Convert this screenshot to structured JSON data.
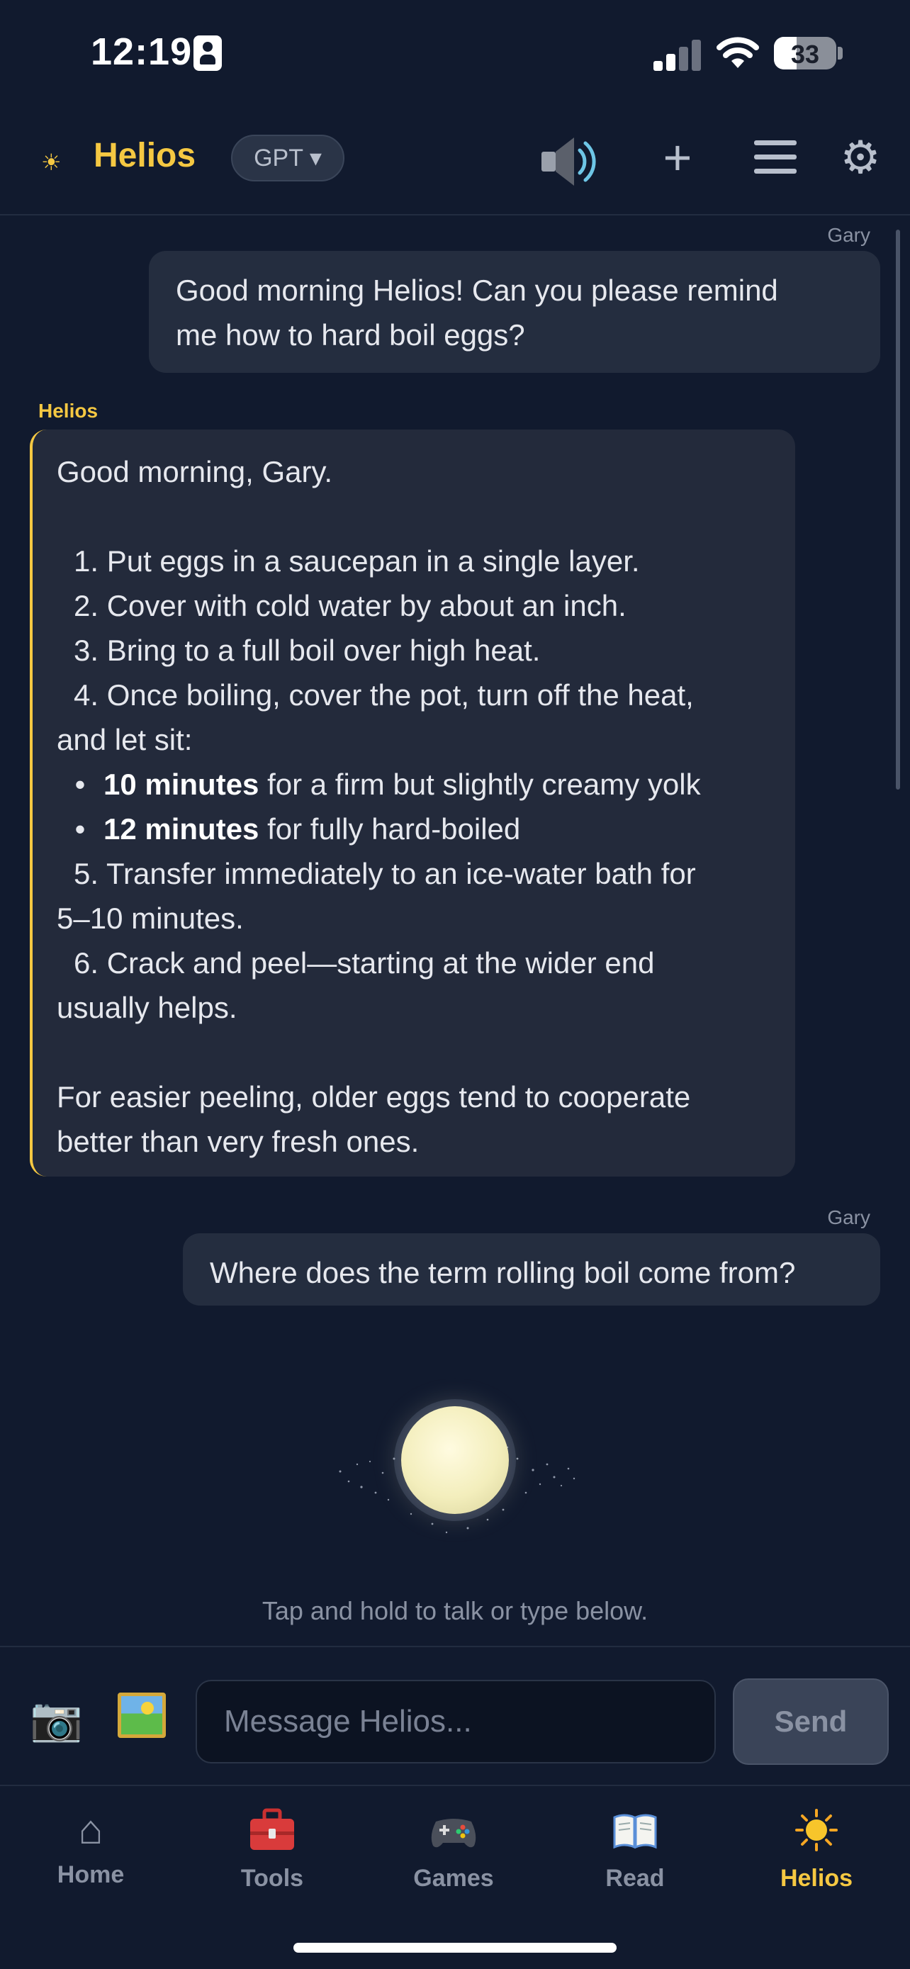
{
  "status_bar": {
    "time": "12:19",
    "battery": "33"
  },
  "header": {
    "title": "Helios",
    "model": "GPT ▾"
  },
  "messages": {
    "user1": {
      "sender": "Gary",
      "lines": [
        "Good morning Helios! Can you please remind",
        "me how to hard boil eggs?"
      ]
    },
    "bot": {
      "sender": "Helios",
      "greeting": "Good morning, Gary.",
      "steps": [
        "1.  Put eggs in a saucepan in a single layer.",
        "2.  Cover with cold water by about an inch.",
        "3.  Bring to a full boil over high heat.",
        "4.  Once boiling, cover the pot, turn off the heat,"
      ],
      "step4_cont": "and let sit:",
      "bullet1_bold": "10 minutes",
      "bullet1_text": " for a firm but slightly creamy yolk",
      "bullet2_bold": "12 minutes",
      "bullet2_text": " for fully hard-boiled",
      "step5": "5.  Transfer immediately to an ice-water bath for",
      "step5_cont": "5–10 minutes.",
      "step6": "6.  Crack and peel—starting at the wider end",
      "step6_cont": "usually helps.",
      "tip_lines": [
        "For easier peeling, older eggs tend to cooperate",
        "better than very fresh ones."
      ]
    },
    "user2": {
      "sender": "Gary",
      "text": "Where does the term rolling boil come from?"
    }
  },
  "hint": "Tap and hold to talk or type below.",
  "composer": {
    "placeholder": "Message Helios...",
    "send_label": "Send"
  },
  "tabs": [
    {
      "label": "Home",
      "icon": "home-icon"
    },
    {
      "label": "Tools",
      "icon": "toolbox-icon"
    },
    {
      "label": "Games",
      "icon": "gamepad-icon"
    },
    {
      "label": "Read",
      "icon": "book-icon"
    },
    {
      "label": "Helios",
      "icon": "sun-icon",
      "active": true
    }
  ],
  "colors": {
    "accent": "#f5c842",
    "background": "#111a2e",
    "bubble": "#242d3f"
  }
}
